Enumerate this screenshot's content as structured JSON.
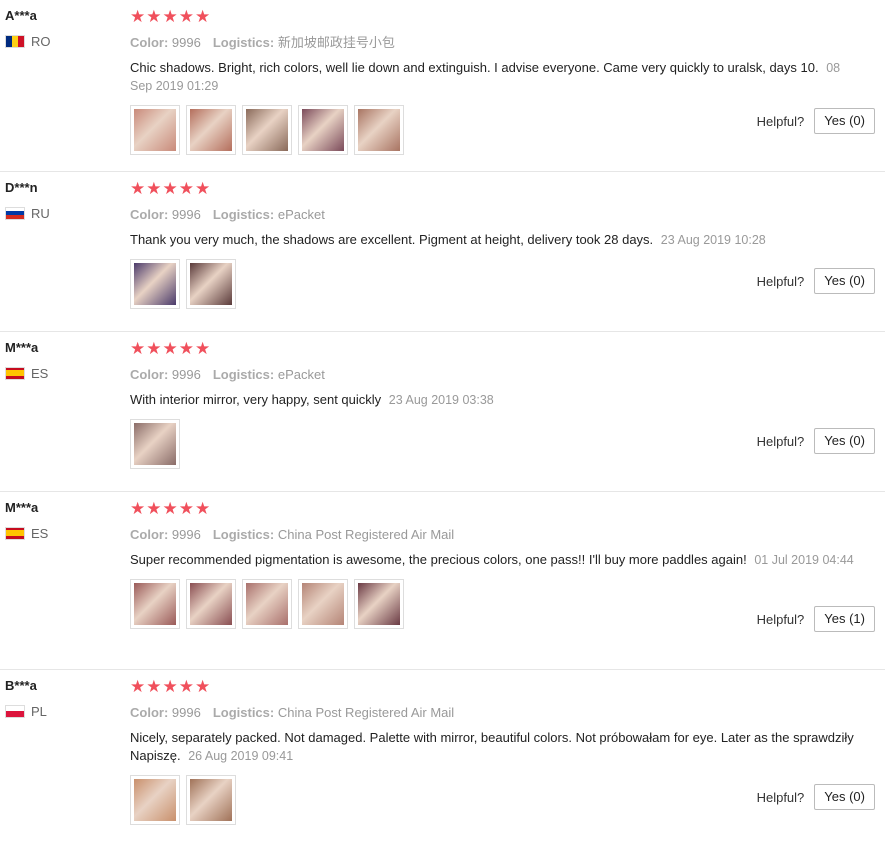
{
  "labels": {
    "color": "Color:",
    "logistics": "Logistics:",
    "helpful": "Helpful?",
    "stars": "★★★★★"
  },
  "reviews": [
    {
      "user": "A***a",
      "country": "RO",
      "flag": "ro",
      "color_value": "9996",
      "logistics_value": "新加坡邮政挂号小包",
      "text": "Chic shadows. Bright, rich colors, well lie down and extinguish. I advise everyone. Came very quickly to uralsk, days 10.",
      "date": "08 Sep 2019 01:29",
      "yes": "Yes (0)",
      "photos": [
        "#c98a7a",
        "#b46e5c",
        "#8a6a5a",
        "#7b4a5a",
        "#a87462"
      ],
      "photo_icon": "palette-photo-icon"
    },
    {
      "user": "D***n",
      "country": "RU",
      "flag": "ru",
      "color_value": "9996",
      "logistics_value": "ePacket",
      "text": "Thank you very much, the shadows are excellent. Pigment at height, delivery took 28 days.",
      "date": "23 Aug 2019 10:28",
      "yes": "Yes (0)",
      "photos": [
        "#4a3a6a",
        "#5a3a3a"
      ],
      "photo_icon": "palette-photo-icon"
    },
    {
      "user": "M***a",
      "country": "ES",
      "flag": "es",
      "color_value": "9996",
      "logistics_value": "ePacket",
      "text": "With interior mirror, very happy, sent quickly",
      "date": "23 Aug 2019 03:38",
      "yes": "Yes (0)",
      "photos": [
        "#8a6c68"
      ],
      "photo_icon": "palette-photo-icon"
    },
    {
      "user": "M***a",
      "country": "ES",
      "flag": "es",
      "color_value": "9996",
      "logistics_value": "China Post Registered Air Mail",
      "text": "Super recommended pigmentation is awesome, the precious colors, one pass!! I'll buy more paddles again!",
      "date": "01 Jul 2019 04:44",
      "yes": "Yes (1)",
      "photos": [
        "#9a5a58",
        "#8a4e52",
        "#a9706c",
        "#b48476",
        "#6a3a44"
      ],
      "photo_icon": "palette-photo-icon"
    },
    {
      "user": "B***a",
      "country": "PL",
      "flag": "pl",
      "color_value": "9996",
      "logistics_value": "China Post Registered Air Mail",
      "text": "Nicely, separately packed. Not damaged. Palette with mirror, beautiful colors. Not próbowałam for eye. Later as the sprawdziły Napiszę.",
      "date": "26 Aug 2019 09:41",
      "yes": "Yes (0)",
      "photos": [
        "#c9906c",
        "#a07258"
      ],
      "photo_icon": "palette-photo-icon"
    }
  ],
  "colors": {
    "star": "#f0505c",
    "divider": "#e6e6e6",
    "meta": "#999999"
  }
}
